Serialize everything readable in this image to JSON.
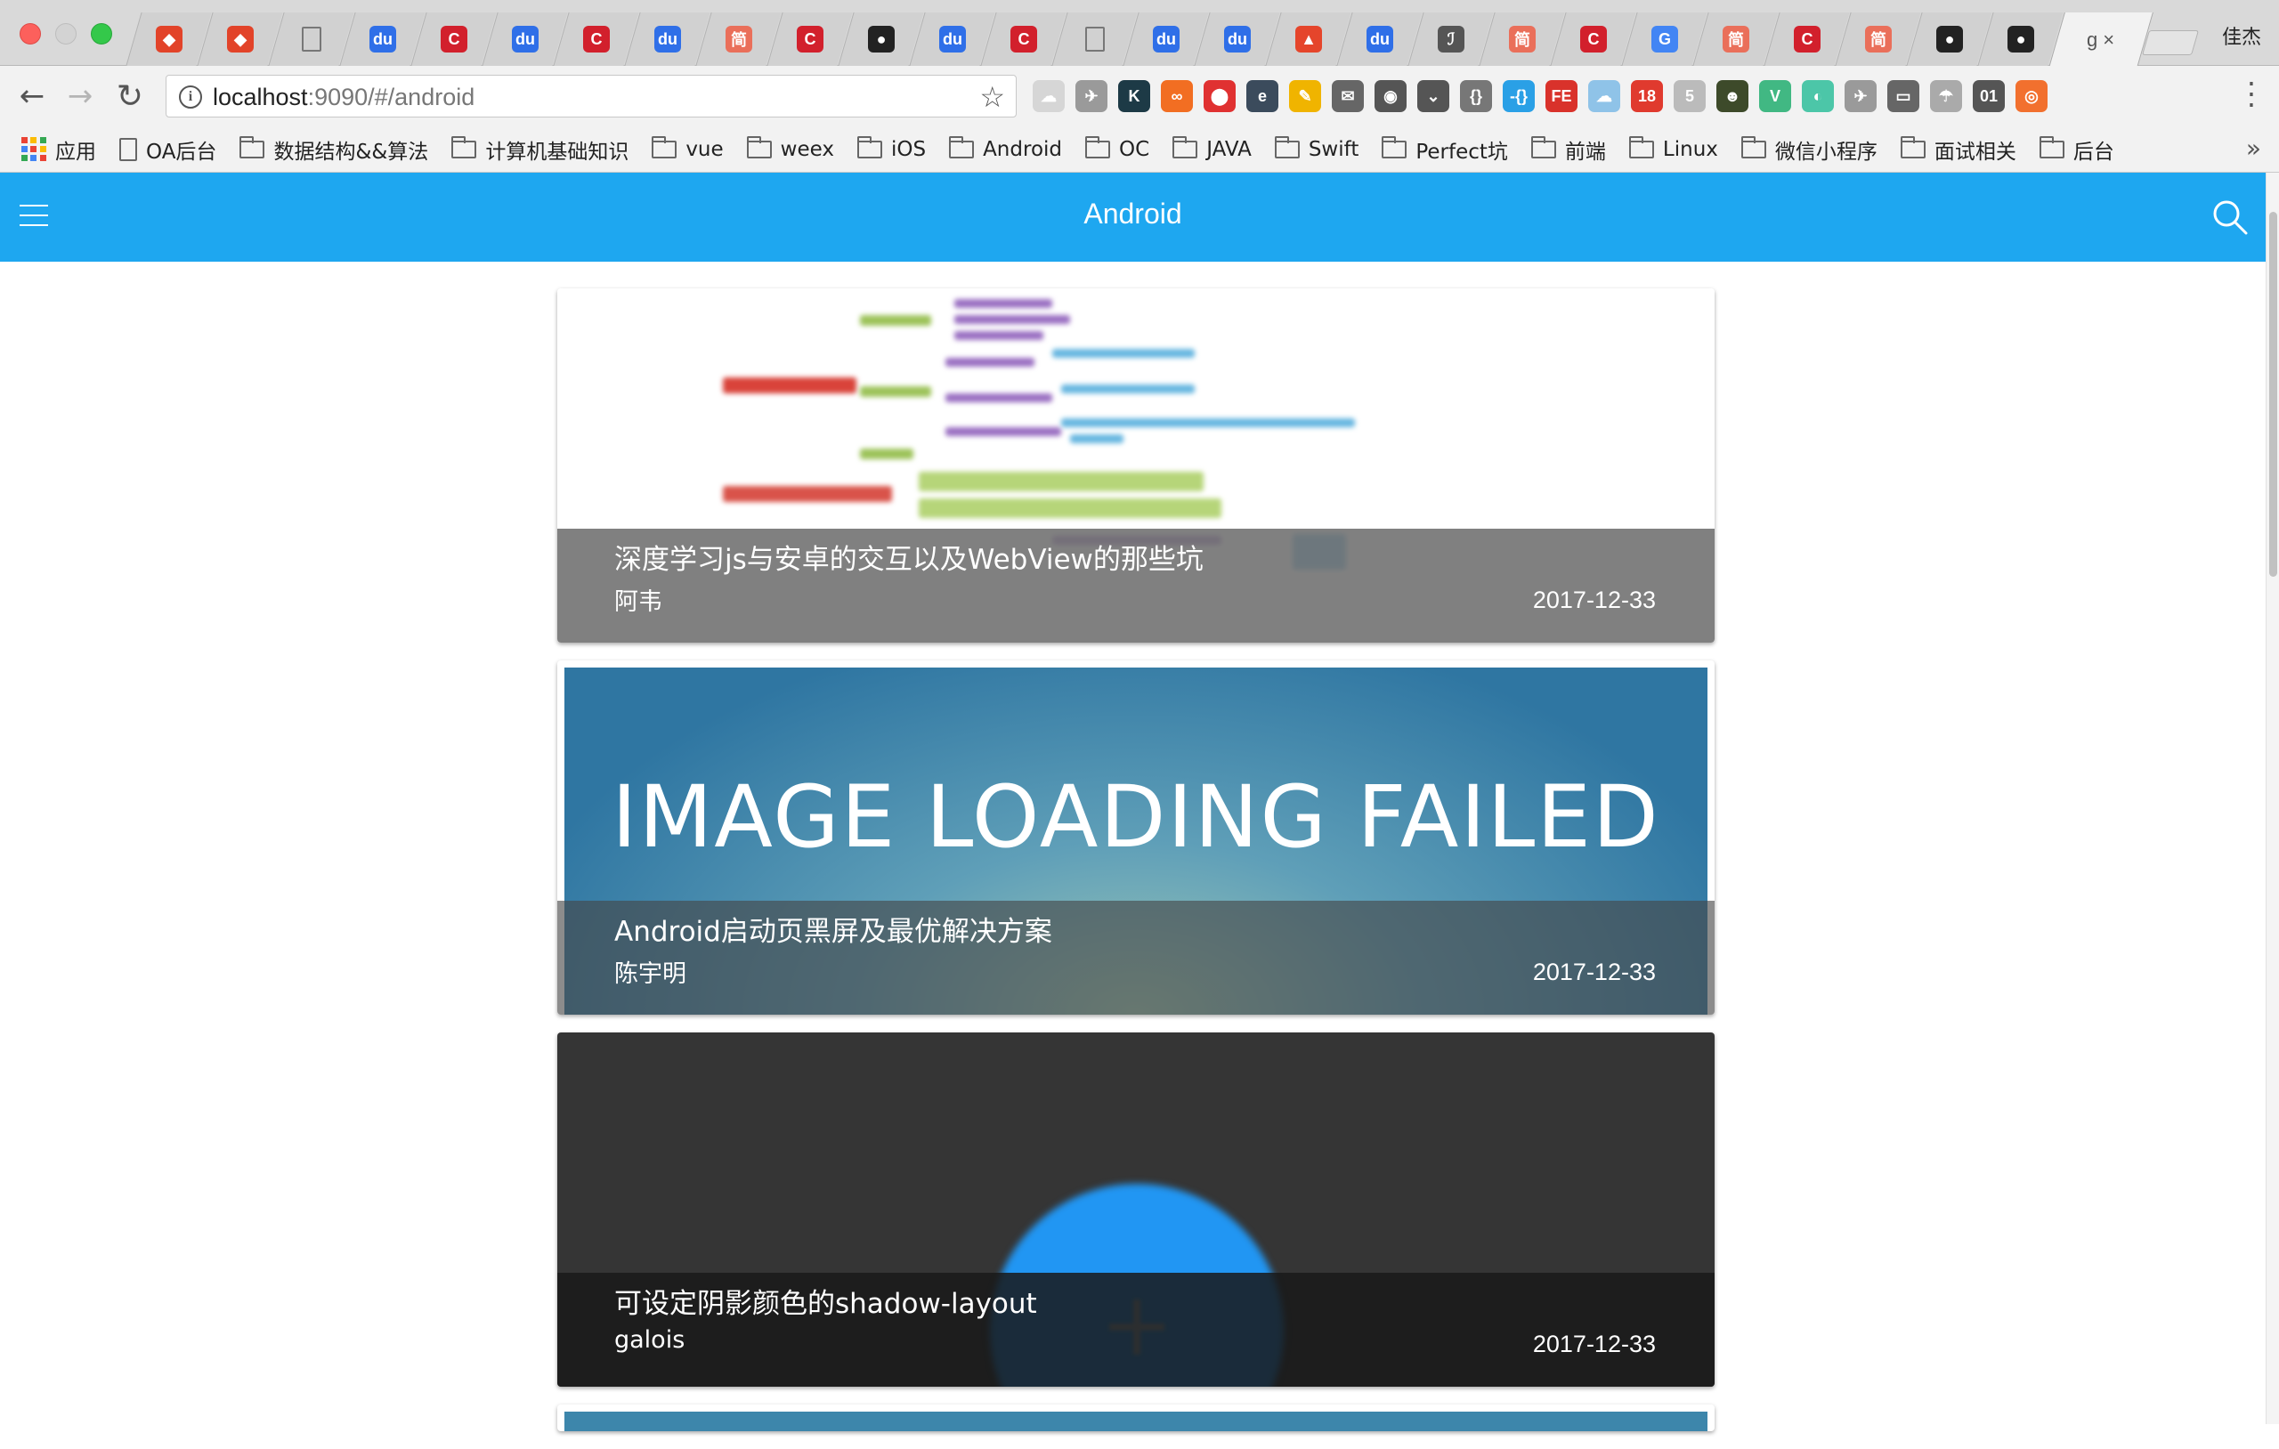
{
  "browser": {
    "tabs": [
      {
        "icon": "gitlab-icon",
        "color": "#e24329",
        "glyph": "◆"
      },
      {
        "icon": "gitlab-icon",
        "color": "#e24329",
        "glyph": "◆"
      },
      {
        "icon": "page-icon",
        "color": "#888888",
        "glyph": ""
      },
      {
        "icon": "baidu-icon",
        "color": "#2f6fe8",
        "glyph": "du"
      },
      {
        "icon": "csdn-icon",
        "color": "#d2202c",
        "glyph": "C"
      },
      {
        "icon": "baidu-icon",
        "color": "#2f6fe8",
        "glyph": "du"
      },
      {
        "icon": "csdn-icon",
        "color": "#d2202c",
        "glyph": "C"
      },
      {
        "icon": "baidu-icon",
        "color": "#2f6fe8",
        "glyph": "du"
      },
      {
        "icon": "jianshu-icon",
        "color": "#ea6f5a",
        "glyph": "简"
      },
      {
        "icon": "csdn-icon",
        "color": "#d2202c",
        "glyph": "C"
      },
      {
        "icon": "github-icon",
        "color": "#222222",
        "glyph": "●"
      },
      {
        "icon": "baidu-icon",
        "color": "#2f6fe8",
        "glyph": "du"
      },
      {
        "icon": "csdn-icon",
        "color": "#d2202c",
        "glyph": "C"
      },
      {
        "icon": "page-icon",
        "color": "#888888",
        "glyph": ""
      },
      {
        "icon": "baidu-icon",
        "color": "#2f6fe8",
        "glyph": "du"
      },
      {
        "icon": "baidu-icon",
        "color": "#2f6fe8",
        "glyph": "du"
      },
      {
        "icon": "flame-icon",
        "color": "#e5452b",
        "glyph": "▲"
      },
      {
        "icon": "baidu-icon",
        "color": "#2f6fe8",
        "glyph": "du"
      },
      {
        "icon": "script-icon",
        "color": "#555555",
        "glyph": "ℐ"
      },
      {
        "icon": "jianshu-icon",
        "color": "#ea6f5a",
        "glyph": "简"
      },
      {
        "icon": "csdn-icon",
        "color": "#d2202c",
        "glyph": "C"
      },
      {
        "icon": "google-icon",
        "color": "#4285f4",
        "glyph": "G"
      },
      {
        "icon": "jianshu-icon",
        "color": "#ea6f5a",
        "glyph": "简"
      },
      {
        "icon": "csdn-icon",
        "color": "#d2202c",
        "glyph": "C"
      },
      {
        "icon": "jianshu-icon",
        "color": "#ea6f5a",
        "glyph": "简"
      },
      {
        "icon": "github-icon",
        "color": "#222222",
        "glyph": "●"
      },
      {
        "icon": "github-icon",
        "color": "#222222",
        "glyph": "●"
      }
    ],
    "active_tab_label": "g",
    "active_tab_close": "×",
    "profile_name": "佳杰",
    "url_host": "localhost",
    "url_rest": ":9090/#/android",
    "extensions": [
      {
        "name": "cloud-ext-icon",
        "color": "#d6d6d6",
        "glyph": "☁"
      },
      {
        "name": "bird-ext-icon",
        "color": "#9a9a9a",
        "glyph": "✈"
      },
      {
        "name": "k-ext-icon",
        "color": "#1d3a46",
        "glyph": "K"
      },
      {
        "name": "infinity-ext-icon",
        "color": "#f26e22",
        "glyph": "∞"
      },
      {
        "name": "shield-ext-icon",
        "color": "#e03131",
        "glyph": "⬤"
      },
      {
        "name": "e-ext-icon",
        "color": "#3b4b5c",
        "glyph": "e"
      },
      {
        "name": "pencil-ext-icon",
        "color": "#f0b400",
        "glyph": "✎"
      },
      {
        "name": "mail-ext-icon",
        "color": "#666666",
        "glyph": "✉"
      },
      {
        "name": "chat-ext-icon",
        "color": "#555555",
        "glyph": "◉"
      },
      {
        "name": "pocket-ext-icon",
        "color": "#555555",
        "glyph": "⌄"
      },
      {
        "name": "braces-ext-icon",
        "color": "#777777",
        "glyph": "{}"
      },
      {
        "name": "json-ext-icon",
        "color": "#2aa0e6",
        "glyph": "-{}"
      },
      {
        "name": "fe-ext-icon",
        "color": "#d9322b",
        "glyph": "FE"
      },
      {
        "name": "cloud2-ext-icon",
        "color": "#8fc3e8",
        "glyph": "☁"
      },
      {
        "name": "calendar-ext-icon",
        "color": "#e03a2e",
        "glyph": "18"
      },
      {
        "name": "five-ext-icon",
        "color": "#bbbbbb",
        "glyph": "5"
      },
      {
        "name": "avatar-ext-icon",
        "color": "#3d4a2a",
        "glyph": "☻"
      },
      {
        "name": "vue-ext-icon",
        "color": "#41b883",
        "glyph": "V"
      },
      {
        "name": "color-ext-icon",
        "color": "#4cc6a8",
        "glyph": "◐"
      },
      {
        "name": "bird2-ext-icon",
        "color": "#9a9a9a",
        "glyph": "✈"
      },
      {
        "name": "cast-ext-icon",
        "color": "#666666",
        "glyph": "▭"
      },
      {
        "name": "parachute-ext-icon",
        "color": "#aaaaaa",
        "glyph": "☂"
      },
      {
        "name": "binary-ext-icon",
        "color": "#555555",
        "glyph": "01"
      },
      {
        "name": "ubuntu-ext-icon",
        "color": "#f2702e",
        "glyph": "◎"
      }
    ],
    "bookmarks": [
      {
        "label": "应用",
        "type": "apps"
      },
      {
        "label": "OA后台",
        "type": "page"
      },
      {
        "label": "数据结构&&算法",
        "type": "folder"
      },
      {
        "label": "计算机基础知识",
        "type": "folder"
      },
      {
        "label": "vue",
        "type": "folder"
      },
      {
        "label": "weex",
        "type": "folder"
      },
      {
        "label": "iOS",
        "type": "folder"
      },
      {
        "label": "Android",
        "type": "folder"
      },
      {
        "label": "OC",
        "type": "folder"
      },
      {
        "label": "JAVA",
        "type": "folder"
      },
      {
        "label": "Swift",
        "type": "folder"
      },
      {
        "label": "Perfect坑",
        "type": "folder"
      },
      {
        "label": "前端",
        "type": "folder"
      },
      {
        "label": "Linux",
        "type": "folder"
      },
      {
        "label": "微信小程序",
        "type": "folder"
      },
      {
        "label": "面试相关",
        "type": "folder"
      },
      {
        "label": "后台",
        "type": "folder"
      }
    ],
    "bookmarks_more": "»"
  },
  "app": {
    "title": "Android",
    "header_color": "#1ea7f0"
  },
  "posts": [
    {
      "title": "深度学习js与安卓的交互以及WebView的那些坑",
      "author": "阿韦",
      "date": "2017-12-33",
      "image": "mindmap"
    },
    {
      "title": "Android启动页黑屏及最优解决方案",
      "author": "陈宇明",
      "date": "2017-12-33",
      "image": "failed",
      "image_text": "IMAGE LOADING FAILED"
    },
    {
      "title": "可设定阴影颜色的shadow-layout",
      "author": "galois",
      "date": "2017-12-33",
      "image": "fab"
    }
  ]
}
